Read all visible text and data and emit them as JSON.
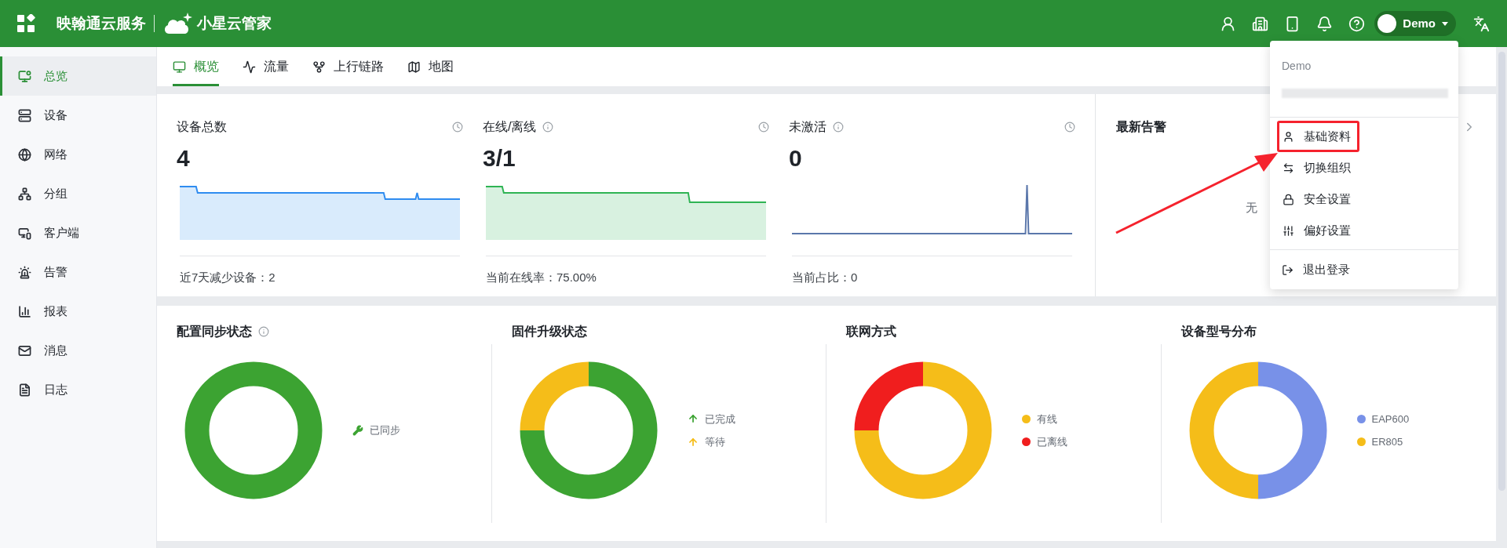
{
  "header": {
    "brand": "映翰通云服务",
    "product": "小星云管家",
    "user": "Demo"
  },
  "sidebar": {
    "items": [
      {
        "label": "总览",
        "selected": true
      },
      {
        "label": "设备",
        "selected": false
      },
      {
        "label": "网络",
        "selected": false
      },
      {
        "label": "分组",
        "selected": false
      },
      {
        "label": "客户端",
        "selected": false
      },
      {
        "label": "告警",
        "selected": false
      },
      {
        "label": "报表",
        "selected": false
      },
      {
        "label": "消息",
        "selected": false
      },
      {
        "label": "日志",
        "selected": false
      }
    ]
  },
  "tabs": [
    {
      "label": "概览",
      "selected": true
    },
    {
      "label": "流量",
      "selected": false
    },
    {
      "label": "上行链路",
      "selected": false
    },
    {
      "label": "地图",
      "selected": false
    }
  ],
  "stats": [
    {
      "title": "设备总数",
      "info": false,
      "value": "4",
      "kind": "total",
      "footer": "近7天减少设备：2"
    },
    {
      "title": "在线/离线",
      "info": true,
      "value": "3/1",
      "kind": "online",
      "footer": "当前在线率：75.00%"
    },
    {
      "title": "未激活",
      "info": true,
      "value": "0",
      "kind": "inactive",
      "footer": "当前占比：0"
    }
  ],
  "alerts": {
    "title": "最新告警",
    "empty_text": "无"
  },
  "user_menu": {
    "name": "Demo",
    "items": [
      {
        "label": "基础资料",
        "highlighted": true
      },
      {
        "label": "切换组织",
        "highlighted": false
      },
      {
        "label": "安全设置",
        "highlighted": false
      },
      {
        "label": "偏好设置",
        "highlighted": false
      }
    ],
    "logout": "退出登录"
  },
  "charts": [
    {
      "title": "配置同步状态",
      "info": true,
      "legend": [
        {
          "label": "已同步",
          "kind": "wrench",
          "color": "#3ca332"
        }
      ]
    },
    {
      "title": "固件升级状态",
      "info": false,
      "legend": [
        {
          "label": "已完成",
          "kind": "arrow",
          "color": "#3ca332"
        },
        {
          "label": "等待",
          "kind": "arrow",
          "color": "#f5bd19"
        }
      ]
    },
    {
      "title": "联网方式",
      "info": false,
      "legend": [
        {
          "label": "有线",
          "kind": "dot",
          "color": "#f5bd19"
        },
        {
          "label": "已离线",
          "kind": "dot",
          "color": "#f01e1e"
        }
      ]
    },
    {
      "title": "设备型号分布",
      "info": false,
      "legend": [
        {
          "label": "EAP600",
          "kind": "dot",
          "color": "#7891e8"
        },
        {
          "label": "ER805",
          "kind": "dot",
          "color": "#f5bd19"
        }
      ]
    }
  ]
}
